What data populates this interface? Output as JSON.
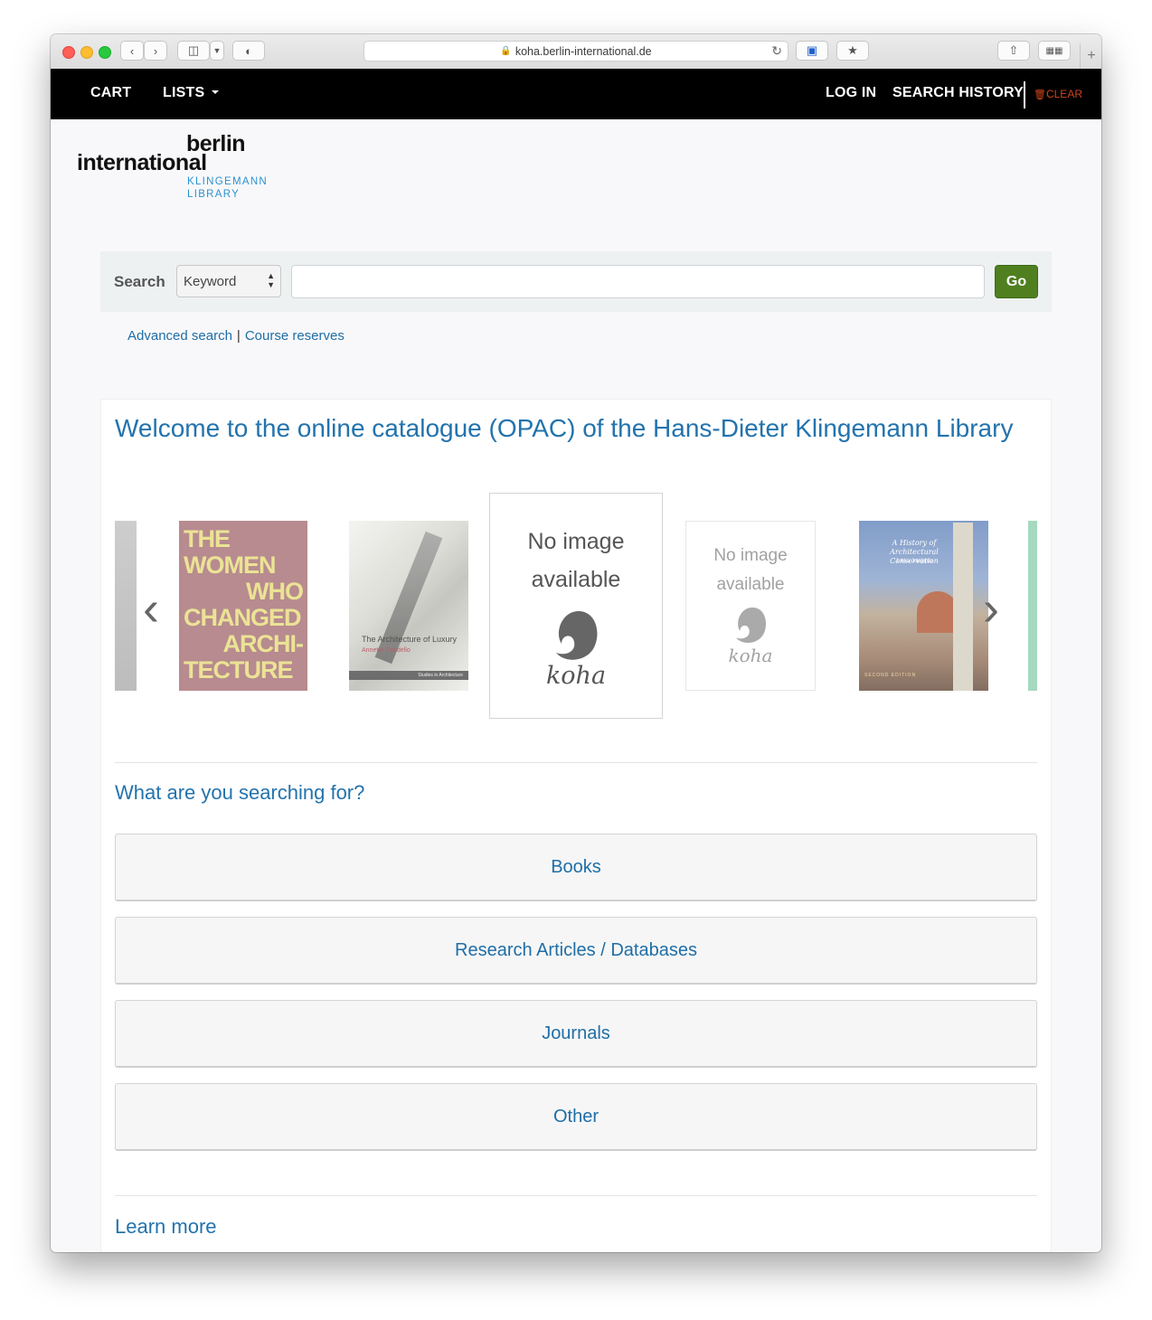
{
  "browser": {
    "url": "koha.berlin-international.de"
  },
  "nav": {
    "cart": "CART",
    "lists": "LISTS",
    "login": "LOG IN",
    "search_history": "SEARCH HISTORY",
    "clear": "CLEAR"
  },
  "logo": {
    "line1": "berlin",
    "line2": "international",
    "line3": "KLINGEMANN",
    "line4": "LIBRARY"
  },
  "search": {
    "label": "Search",
    "type_selected": "Keyword",
    "query": "",
    "go": "Go"
  },
  "links": {
    "advanced": "Advanced search",
    "separator": "|",
    "course": "Course reserves"
  },
  "welcome": "Welcome to the online catalogue (OPAC) of the Hans-Dieter Klingemann Library",
  "carousel": {
    "covers": [
      {
        "type": "image",
        "title_lines": [
          "THE",
          "WOMEN",
          "WHO",
          "CHANGED",
          "ARCHI-",
          "TECTURE"
        ]
      },
      {
        "type": "image",
        "title": "The Architecture of Luxury",
        "author": "Annette Condello",
        "series": "Studies in Architecture"
      },
      {
        "type": "noimage",
        "line1": "No image",
        "line2": "available",
        "logo": "koha"
      },
      {
        "type": "noimage",
        "line1": "No image",
        "line2": "available",
        "logo": "koha"
      },
      {
        "type": "image",
        "title_lines": [
          "A History of",
          "Architectural Conservation"
        ],
        "author": "Jukka Jokilehto",
        "edition": "SECOND EDITION"
      }
    ]
  },
  "searching_heading": "What are you searching for?",
  "categories": [
    "Books",
    "Research Articles / Databases",
    "Journals",
    "Other"
  ],
  "learn_more": "Learn more",
  "colors": {
    "link": "#2373ad",
    "go_button": "#4f7f1f",
    "clear": "#d0451b",
    "logo_accent": "#2a91d0"
  }
}
